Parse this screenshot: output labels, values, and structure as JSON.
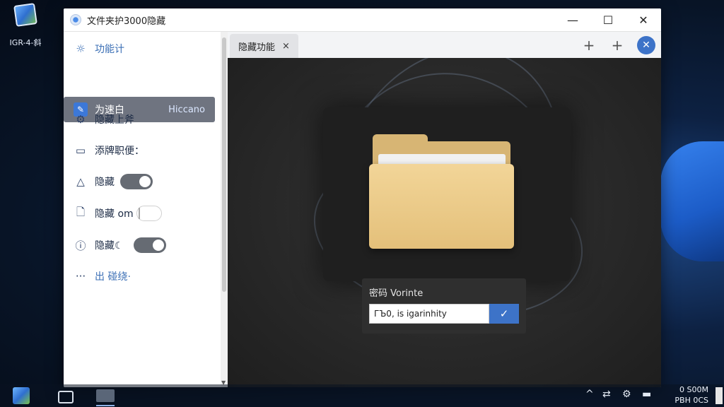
{
  "desktop": {
    "icon_label": "IGR-4-斜",
    "icon_name": "app-shortcut-icon"
  },
  "window": {
    "title": "文件夹护3000隐藏",
    "minimize": "—",
    "maximize": "☐",
    "close": "✕"
  },
  "sidebar": {
    "header": "功能计",
    "active_item": {
      "label": "为速白",
      "sub": "Hiccano"
    },
    "items": [
      {
        "label": "隐藏上斧",
        "icon": "gear-icon"
      },
      {
        "label": "添牌职便：",
        "icon": "folder-icon"
      },
      {
        "label": "隐藏",
        "icon": "warning-icon",
        "toggle": "on"
      },
      {
        "label": "隐藏 om",
        "icon": "document-icon",
        "toggle": "off"
      },
      {
        "label": "隐藏☾",
        "icon": "info-icon",
        "toggle": "on"
      }
    ],
    "more": "出 碰绕·"
  },
  "tabs": [
    {
      "label": "隐藏功能",
      "close": "×"
    }
  ],
  "toolbar": {
    "add1": "+",
    "add2": "+",
    "close": "✕"
  },
  "password": {
    "label": "密码 Vorinte",
    "value": "ГЪ0, is igarinhity",
    "submit_icon": "✓"
  },
  "taskbar": {
    "clock_time": "0 S00M",
    "clock_date": "PBH 0CS",
    "tray": [
      "^",
      "⇄",
      "⚙",
      "▬"
    ]
  },
  "colors": {
    "accent": "#3d73c8",
    "folder": "#e4c07a",
    "sidebar_active": "#6f7480"
  }
}
